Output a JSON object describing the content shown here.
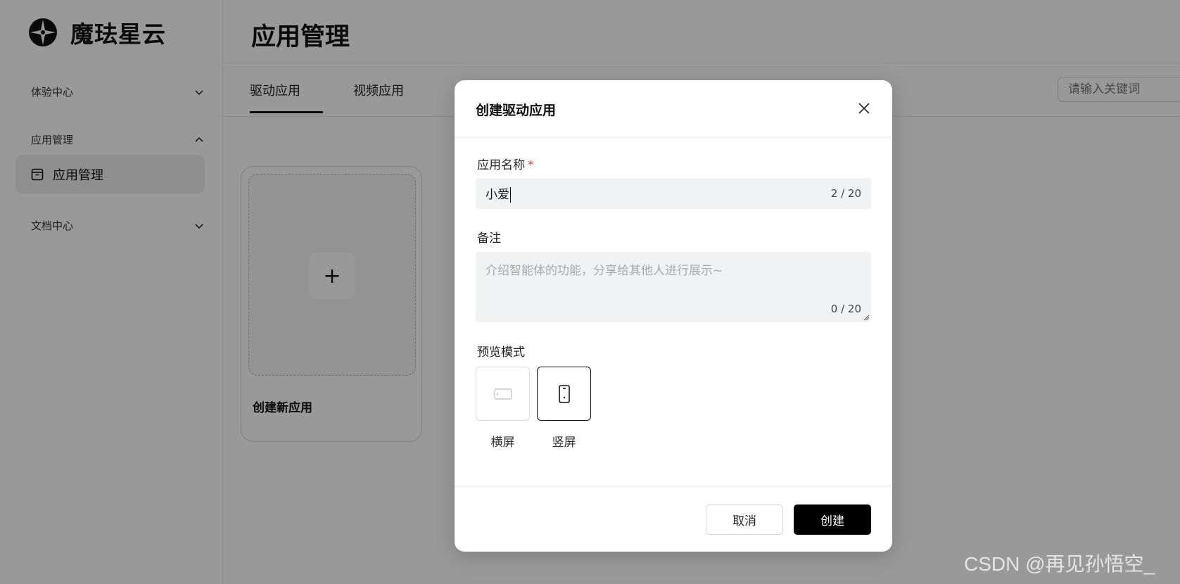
{
  "brand": {
    "name": "魔珐星云"
  },
  "sidebar": {
    "groups": [
      {
        "label": "体验中心",
        "expanded": false
      },
      {
        "label": "应用管理",
        "expanded": true
      },
      {
        "label": "文档中心",
        "expanded": false
      }
    ],
    "active_item": {
      "label": "应用管理",
      "icon": "archive-icon"
    }
  },
  "main": {
    "title": "应用管理",
    "tabs": [
      {
        "label": "驱动应用",
        "active": true
      },
      {
        "label": "视频应用",
        "active": false
      }
    ],
    "search": {
      "placeholder": "请输入关键词"
    },
    "new_card": {
      "label": "创建新应用",
      "icon": "plus-icon"
    }
  },
  "modal": {
    "title": "创建驱动应用",
    "name_field": {
      "label": "应用名称",
      "required_mark": "*",
      "value": "小爱",
      "counter": "2 / 20"
    },
    "note_field": {
      "label": "备注",
      "placeholder": "介绍智能体的功能，分享给其他人进行展示~",
      "counter": "0 / 20"
    },
    "preview_mode": {
      "label": "预览模式",
      "options": [
        {
          "label": "横屏",
          "selected": false,
          "icon": "landscape-icon"
        },
        {
          "label": "竖屏",
          "selected": true,
          "icon": "portrait-icon"
        }
      ]
    },
    "cancel_label": "取消",
    "create_label": "创建"
  },
  "watermark": "CSDN @再见孙悟空_",
  "colors": {
    "primary": "#000000",
    "required": "#e23b3b",
    "input_bg": "#f1f2f3",
    "overlay": "rgba(0,0,0,0.40)"
  }
}
